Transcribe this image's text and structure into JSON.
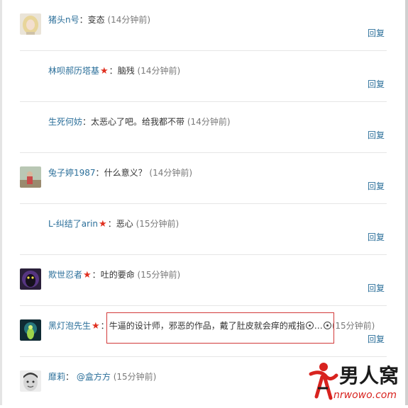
{
  "reply_label": "回复",
  "comments": [
    {
      "user": "猪头n号",
      "star": false,
      "text": "变态",
      "time": "(14分钟前)",
      "avatar": "blonde-girl-avatar"
    },
    {
      "user": "林呗郝历塔基",
      "star": true,
      "text": "脑残",
      "time": "(14分钟前)",
      "avatar": ""
    },
    {
      "user": "生死何妨",
      "star": false,
      "text": "太恶心了吧。给我都不带",
      "time": "(14分钟前)",
      "avatar": ""
    },
    {
      "user": "兔子婷1987",
      "star": false,
      "text": "什么意义？",
      "time": "(14分钟前)",
      "avatar": "girl-outdoors-avatar"
    },
    {
      "user": "L-纠结了arin",
      "star": true,
      "text": "恶心",
      "time": "(15分钟前)",
      "avatar": ""
    },
    {
      "user": "欺世忍者",
      "star": true,
      "text": "吐的要命",
      "time": "(15分钟前)",
      "avatar": "dark-creature-avatar"
    },
    {
      "user": "黑灯泡先生",
      "star": true,
      "text": "牛逼的设计师，邪恶的作品，戴了肚皮就会痒的戒指",
      "time": "(15分钟前)",
      "avatar": "green-creature-avatar"
    },
    {
      "user": "靡莉",
      "star": false,
      "text": "",
      "mention": "@盒方方",
      "time": "(15分钟前)",
      "avatar": "child-face-avatar"
    }
  ],
  "watermark": {
    "brand": "男人窝",
    "url": "nrwowo.com"
  },
  "colors": {
    "link": "#2b6f9a",
    "star": "#e03020",
    "highlight_border": "#d23a3a",
    "watermark_red": "#d8231f"
  }
}
